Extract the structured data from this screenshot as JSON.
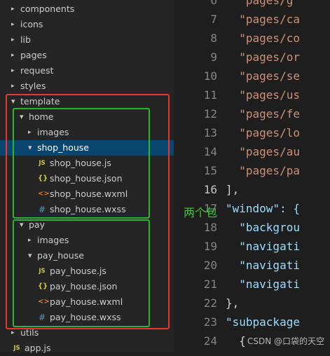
{
  "explorer": {
    "items": [
      {
        "label": "components",
        "kind": "folder",
        "state": "collapsed"
      },
      {
        "label": "icons",
        "kind": "folder",
        "state": "collapsed"
      },
      {
        "label": "lib",
        "kind": "folder",
        "state": "collapsed"
      },
      {
        "label": "pages",
        "kind": "folder",
        "state": "collapsed"
      },
      {
        "label": "request",
        "kind": "folder",
        "state": "collapsed"
      },
      {
        "label": "styles",
        "kind": "folder",
        "state": "collapsed"
      },
      {
        "label": "template",
        "kind": "folder",
        "state": "expanded"
      },
      {
        "label": "home",
        "kind": "folder",
        "state": "expanded"
      },
      {
        "label": "images",
        "kind": "folder",
        "state": "collapsed"
      },
      {
        "label": "shop_house",
        "kind": "folder",
        "state": "expanded",
        "selected": true
      },
      {
        "label": "shop_house.js",
        "kind": "js"
      },
      {
        "label": "shop_house.json",
        "kind": "json"
      },
      {
        "label": "shop_house.wxml",
        "kind": "wxml"
      },
      {
        "label": "shop_house.wxss",
        "kind": "wxss"
      },
      {
        "label": "pay",
        "kind": "folder",
        "state": "expanded"
      },
      {
        "label": "images",
        "kind": "folder",
        "state": "collapsed"
      },
      {
        "label": "pay_house",
        "kind": "folder",
        "state": "expanded"
      },
      {
        "label": "pay_house.js",
        "kind": "js"
      },
      {
        "label": "pay_house.json",
        "kind": "json"
      },
      {
        "label": "pay_house.wxml",
        "kind": "wxml"
      },
      {
        "label": "pay_house.wxss",
        "kind": "wxss"
      },
      {
        "label": "utils",
        "kind": "folder",
        "state": "collapsed"
      },
      {
        "label": "app.js",
        "kind": "js"
      }
    ]
  },
  "editor": {
    "current_line": "16",
    "lines": [
      {
        "n": "6",
        "text": "  \"pages/g",
        "type": "str"
      },
      {
        "n": "7",
        "text": "  \"pages/ca",
        "type": "str"
      },
      {
        "n": "8",
        "text": "  \"pages/co",
        "type": "str"
      },
      {
        "n": "9",
        "text": "  \"pages/or",
        "type": "str"
      },
      {
        "n": "10",
        "text": "  \"pages/se",
        "type": "str"
      },
      {
        "n": "11",
        "text": "  \"pages/us",
        "type": "str"
      },
      {
        "n": "12",
        "text": "  \"pages/fe",
        "type": "str"
      },
      {
        "n": "13",
        "text": "  \"pages/lo",
        "type": "str"
      },
      {
        "n": "14",
        "text": "  \"pages/au",
        "type": "str"
      },
      {
        "n": "15",
        "text": "  \"pages/pa",
        "type": "str"
      },
      {
        "n": "16",
        "text": "],",
        "type": "punct"
      },
      {
        "n": "17",
        "text": "\"window\": {",
        "type": "key"
      },
      {
        "n": "18",
        "text": "  \"backgrou",
        "type": "key"
      },
      {
        "n": "19",
        "text": "  \"navigati",
        "type": "key"
      },
      {
        "n": "20",
        "text": "  \"navigati",
        "type": "key"
      },
      {
        "n": "21",
        "text": "  \"navigati",
        "type": "key"
      },
      {
        "n": "22",
        "text": "},",
        "type": "punct"
      },
      {
        "n": "23",
        "text": "\"subpackage",
        "type": "key"
      },
      {
        "n": "24",
        "text": "  {",
        "type": "punct"
      }
    ]
  },
  "annotation": {
    "text": "两个包",
    "color": "#2bb62b"
  },
  "boxes": {
    "outer_color": "#e8362d",
    "inner_color": "#2bb62b"
  },
  "watermark": "CSDN @口袋的天空",
  "colors": {
    "js": "#cbcb41",
    "json": "#cbcb41",
    "wxml": "#e37933",
    "wxss": "#519aba",
    "selected": "#094771"
  }
}
